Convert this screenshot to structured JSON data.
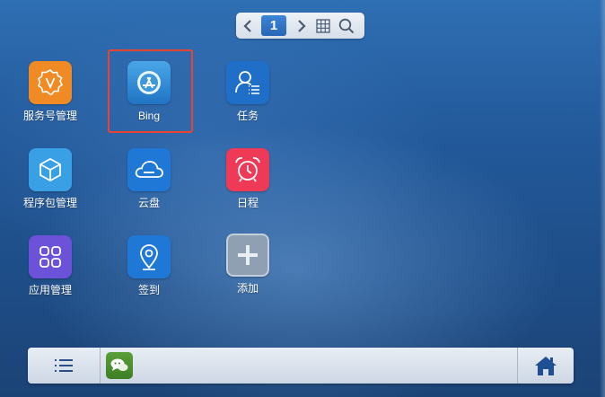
{
  "pager": {
    "prev_icon": "chevron-left-icon",
    "current_page": "1",
    "next_icon": "chevron-right-icon",
    "grid_icon": "grid-icon",
    "search_icon": "search-icon"
  },
  "apps": [
    {
      "label": "服务号管理",
      "icon": "badge-v-icon",
      "color": "#f08a24"
    },
    {
      "label": "Bing",
      "icon": "app-store-icon",
      "color": "#2f8fd6",
      "selected": true
    },
    {
      "label": "任务",
      "icon": "user-list-icon",
      "color": "#1f6fc8"
    },
    {
      "label": "程序包管理",
      "icon": "cube-icon",
      "color": "#3aa0e6"
    },
    {
      "label": "云盘",
      "icon": "cloud-icon",
      "color": "#1f78d6"
    },
    {
      "label": "日程",
      "icon": "alarm-clock-icon",
      "color": "#ee3a56"
    },
    {
      "label": "应用管理",
      "icon": "app-grid-icon",
      "color": "#6b52d9"
    },
    {
      "label": "签到",
      "icon": "location-pin-icon",
      "color": "#1f78d6"
    },
    {
      "label": "添加",
      "icon": "plus-icon",
      "color": "#8fa0b3"
    }
  ],
  "dock": {
    "menu_icon": "list-menu-icon",
    "chat_icon": "chat-bubble-icon",
    "home_icon": "home-icon"
  }
}
